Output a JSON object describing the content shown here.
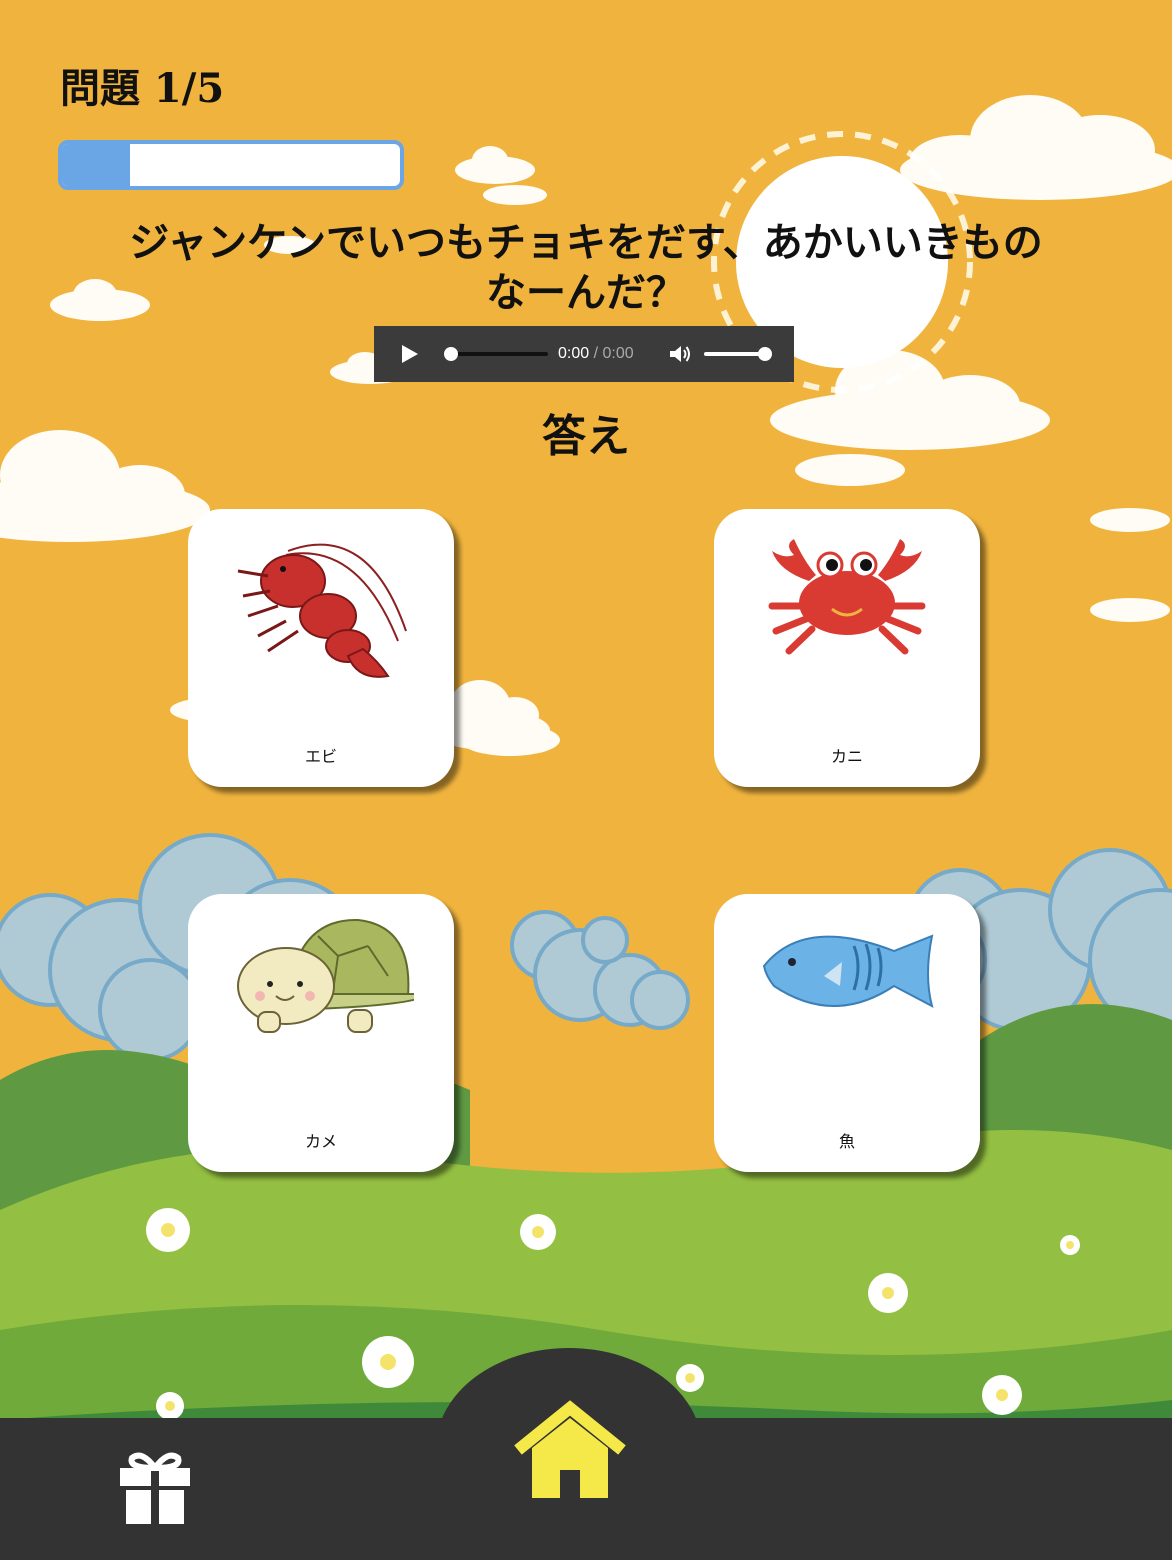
{
  "quiz": {
    "progress_label": "問題 1/5",
    "progress_value": 0.2,
    "question": "ジャンケンでいつもチョキをだす、あかいいきもの\nなーんだ？",
    "answer_heading": "答え"
  },
  "audio": {
    "current_time": "0:00",
    "separator": " / ",
    "duration": "0:00"
  },
  "choices": [
    {
      "label": "エビ",
      "icon": "shrimp-icon"
    },
    {
      "label": "カニ",
      "icon": "crab-icon"
    },
    {
      "label": "カメ",
      "icon": "turtle-icon"
    },
    {
      "label": "魚",
      "icon": "fish-icon"
    }
  ],
  "footer": {
    "left_icon": "gift-icon",
    "center_icon": "home-icon",
    "accent_color": "#f5e94a"
  },
  "colors": {
    "background": "#f0b43e",
    "progress": "#6aa6e6",
    "footer": "#333333"
  }
}
